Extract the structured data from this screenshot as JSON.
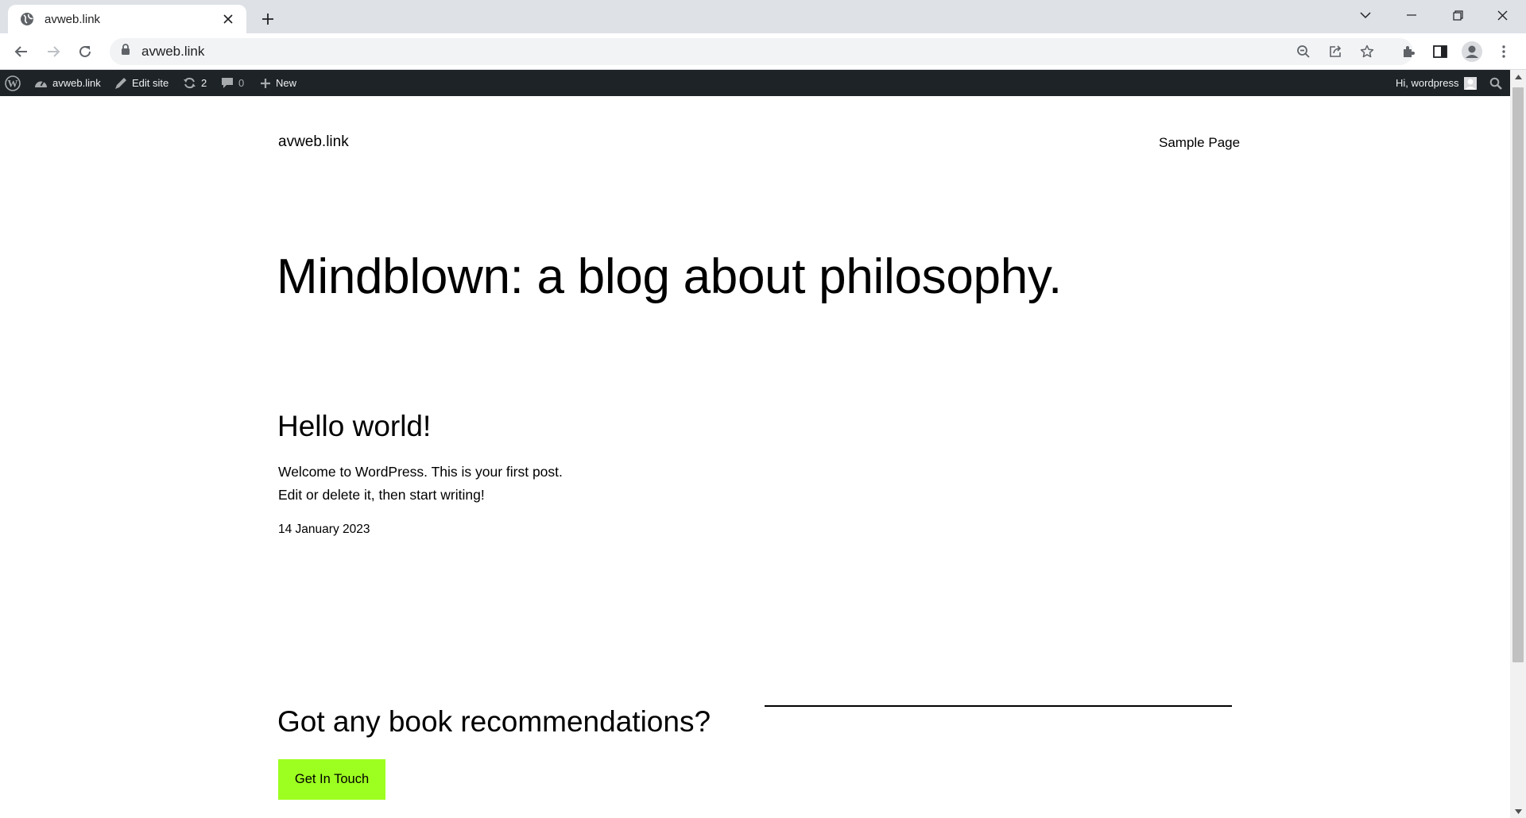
{
  "browser": {
    "tab": {
      "title": "avweb.link",
      "favicon": "globe-icon"
    },
    "address": {
      "url": "avweb.link",
      "lock_icon": "lock-icon"
    },
    "toolbar_icons": [
      "back-icon",
      "forward-icon",
      "reload-icon",
      "zoom-out-icon",
      "share-icon",
      "star-icon",
      "extensions-icon",
      "side-panel-icon",
      "profile-icon",
      "menu-icon"
    ],
    "window_controls": [
      "tab-search-icon",
      "minimize-icon",
      "restore-icon",
      "close-icon"
    ]
  },
  "adminbar": {
    "site_name": "avweb.link",
    "edit_site": "Edit site",
    "updates_count": "2",
    "comments_count": "0",
    "new_label": "New",
    "greeting": "Hi, wordpress"
  },
  "site": {
    "title": "avweb.link",
    "nav": {
      "sample_page": "Sample Page"
    }
  },
  "hero": {
    "heading": "Mindblown: a blog about philosophy."
  },
  "post": {
    "title": "Hello world!",
    "excerpt_line1": "Welcome to WordPress. This is your first post.",
    "excerpt_line2": "Edit or delete it, then start writing!",
    "date": "14 January 2023"
  },
  "cta": {
    "heading": "Got any book recommendations?",
    "button_label": "Get In Touch",
    "button_color": "#9dff20"
  },
  "colors": {
    "adminbar_bg": "#1d2327",
    "tabstrip_bg": "#dee1e6",
    "omnibox_bg": "#f1f3f4"
  }
}
